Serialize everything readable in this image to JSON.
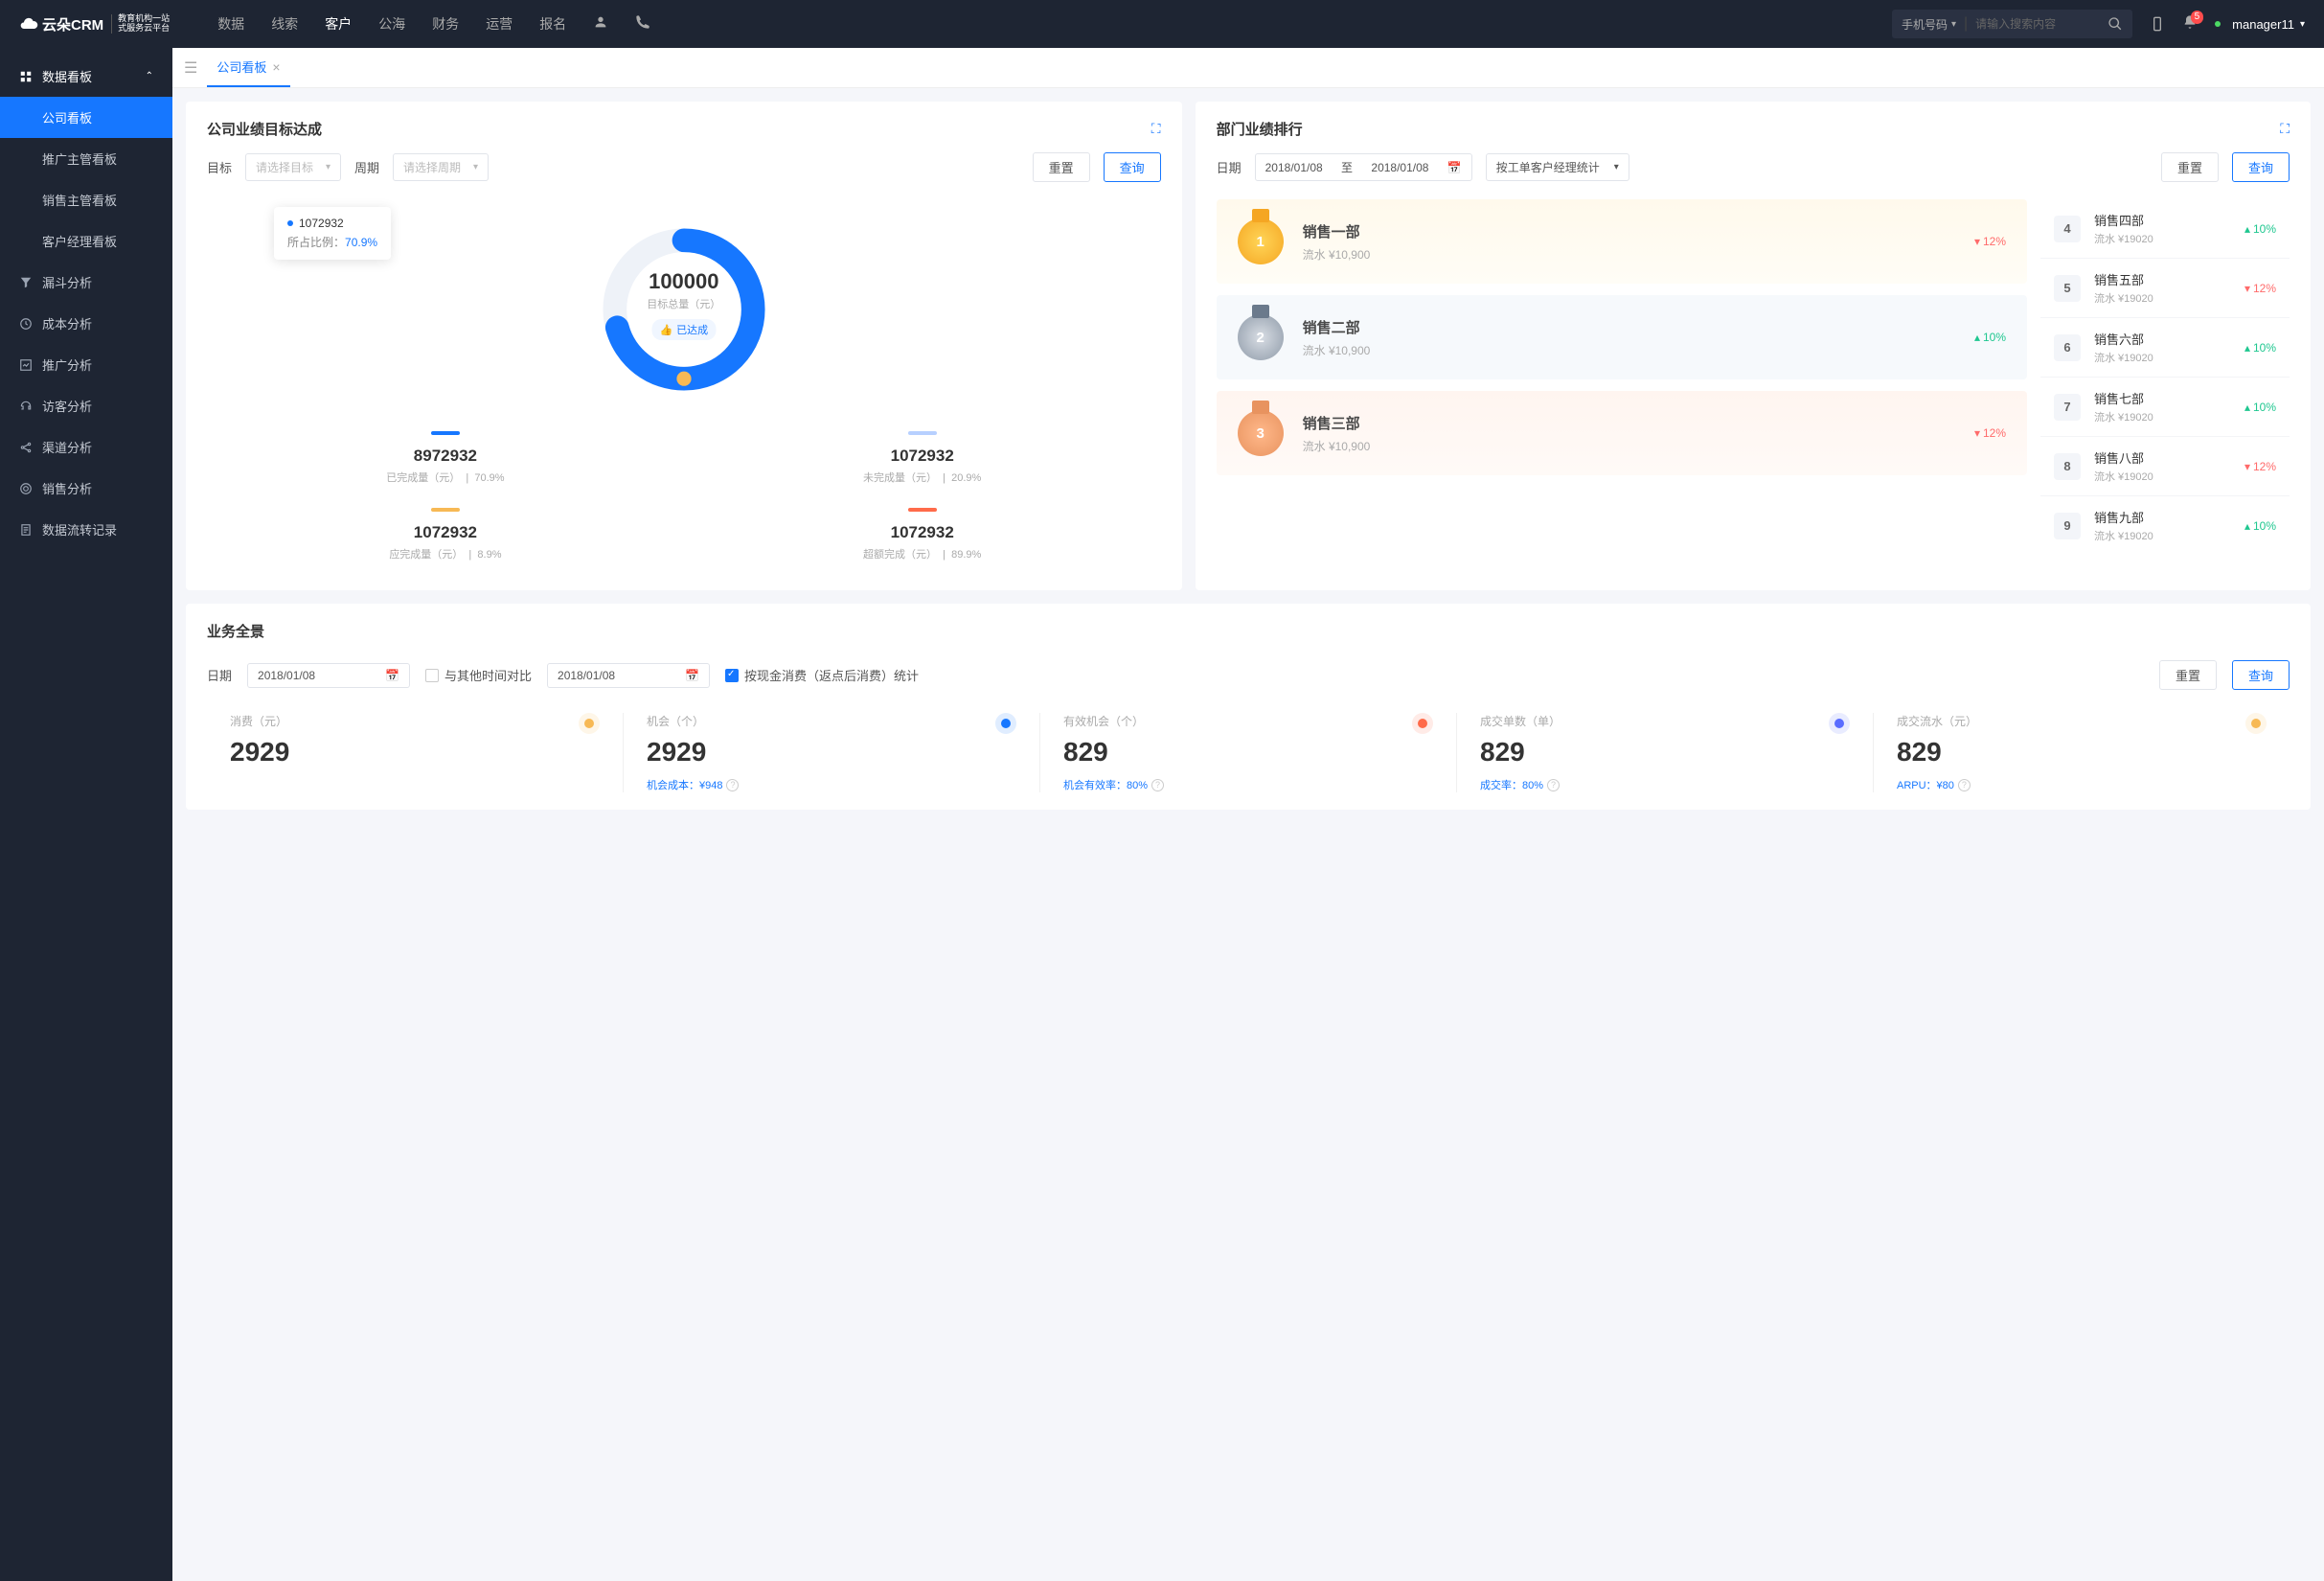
{
  "brand": {
    "name": "云朵CRM",
    "sub1": "教育机构一站",
    "sub2": "式服务云平台"
  },
  "topnav": [
    "数据",
    "线索",
    "客户",
    "公海",
    "财务",
    "运营",
    "报名"
  ],
  "topnav_active": 2,
  "search": {
    "selector": "手机号码",
    "placeholder": "请输入搜索内容"
  },
  "badge": "5",
  "user": "manager11",
  "sidebar": {
    "section": "数据看板",
    "subs": [
      "公司看板",
      "推广主管看板",
      "销售主管看板",
      "客户经理看板"
    ],
    "active_sub": 0,
    "items": [
      "漏斗分析",
      "成本分析",
      "推广分析",
      "访客分析",
      "渠道分析",
      "销售分析",
      "数据流转记录"
    ]
  },
  "tab": {
    "label": "公司看板"
  },
  "goal": {
    "title": "公司业绩目标达成",
    "lbl_target": "目标",
    "ph_target": "请选择目标",
    "lbl_period": "周期",
    "ph_period": "请选择周期",
    "btn_reset": "重置",
    "btn_query": "查询",
    "tooltip": {
      "value": "1072932",
      "ratio_label": "所占比例：",
      "ratio": "70.9%"
    },
    "center": {
      "value": "100000",
      "label": "目标总量（元）",
      "badge": "已达成"
    },
    "metrics": [
      {
        "color": "#1677ff",
        "value": "8972932",
        "label": "已完成量（元）",
        "pct": "70.9%"
      },
      {
        "color": "#b7d0ff",
        "value": "1072932",
        "label": "未完成量（元）",
        "pct": "20.9%"
      },
      {
        "color": "#f7b955",
        "value": "1072932",
        "label": "应完成量（元）",
        "pct": "8.9%"
      },
      {
        "color": "#ff6b4a",
        "value": "1072932",
        "label": "超额完成（元）",
        "pct": "89.9%"
      }
    ]
  },
  "rank": {
    "title": "部门业绩排行",
    "lbl_date": "日期",
    "date1": "2018/01/08",
    "to": "至",
    "date2": "2018/01/08",
    "stat_by": "按工单客户经理统计",
    "btn_reset": "重置",
    "btn_query": "查询",
    "top3": [
      {
        "name": "销售一部",
        "sub": "流水 ¥10,900",
        "pct": "12%",
        "dir": "down"
      },
      {
        "name": "销售二部",
        "sub": "流水 ¥10,900",
        "pct": "10%",
        "dir": "up"
      },
      {
        "name": "销售三部",
        "sub": "流水 ¥10,900",
        "pct": "12%",
        "dir": "down"
      }
    ],
    "rest": [
      {
        "n": "4",
        "name": "销售四部",
        "sub": "流水 ¥19020",
        "pct": "10%",
        "dir": "up"
      },
      {
        "n": "5",
        "name": "销售五部",
        "sub": "流水 ¥19020",
        "pct": "12%",
        "dir": "down"
      },
      {
        "n": "6",
        "name": "销售六部",
        "sub": "流水 ¥19020",
        "pct": "10%",
        "dir": "up"
      },
      {
        "n": "7",
        "name": "销售七部",
        "sub": "流水 ¥19020",
        "pct": "10%",
        "dir": "up"
      },
      {
        "n": "8",
        "name": "销售八部",
        "sub": "流水 ¥19020",
        "pct": "12%",
        "dir": "down"
      },
      {
        "n": "9",
        "name": "销售九部",
        "sub": "流水 ¥19020",
        "pct": "10%",
        "dir": "up"
      }
    ]
  },
  "biz": {
    "title": "业务全景",
    "lbl_date": "日期",
    "date1": "2018/01/08",
    "compare": "与其他时间对比",
    "date2": "2018/01/08",
    "stat": "按现金消费（返点后消费）统计",
    "btn_reset": "重置",
    "btn_query": "查询",
    "kpis": [
      {
        "label": "消费（元）",
        "value": "2929",
        "sub": "",
        "icon": "#f7b955"
      },
      {
        "label": "机会（个）",
        "value": "2929",
        "sub": "机会成本：¥948",
        "icon": "#1677ff"
      },
      {
        "label": "有效机会（个）",
        "value": "829",
        "sub": "机会有效率：80%",
        "icon": "#ff6b4a"
      },
      {
        "label": "成交单数（单）",
        "value": "829",
        "sub": "成交率：80%",
        "icon": "#5a6dff"
      },
      {
        "label": "成交流水（元）",
        "value": "829",
        "sub": "ARPU：¥80",
        "icon": "#f7b955"
      }
    ]
  },
  "chart_data": {
    "type": "pie",
    "title": "公司业绩目标达成",
    "total": 100000,
    "series": [
      {
        "name": "已完成量",
        "value": 8972932,
        "pct": 70.9,
        "color": "#1677ff"
      },
      {
        "name": "未完成量",
        "value": 1072932,
        "pct": 20.9,
        "color": "#b7d0ff"
      },
      {
        "name": "应完成量",
        "value": 1072932,
        "pct": 8.9,
        "color": "#f7b955"
      },
      {
        "name": "超额完成",
        "value": 1072932,
        "pct": 89.9,
        "color": "#ff6b4a"
      }
    ]
  }
}
